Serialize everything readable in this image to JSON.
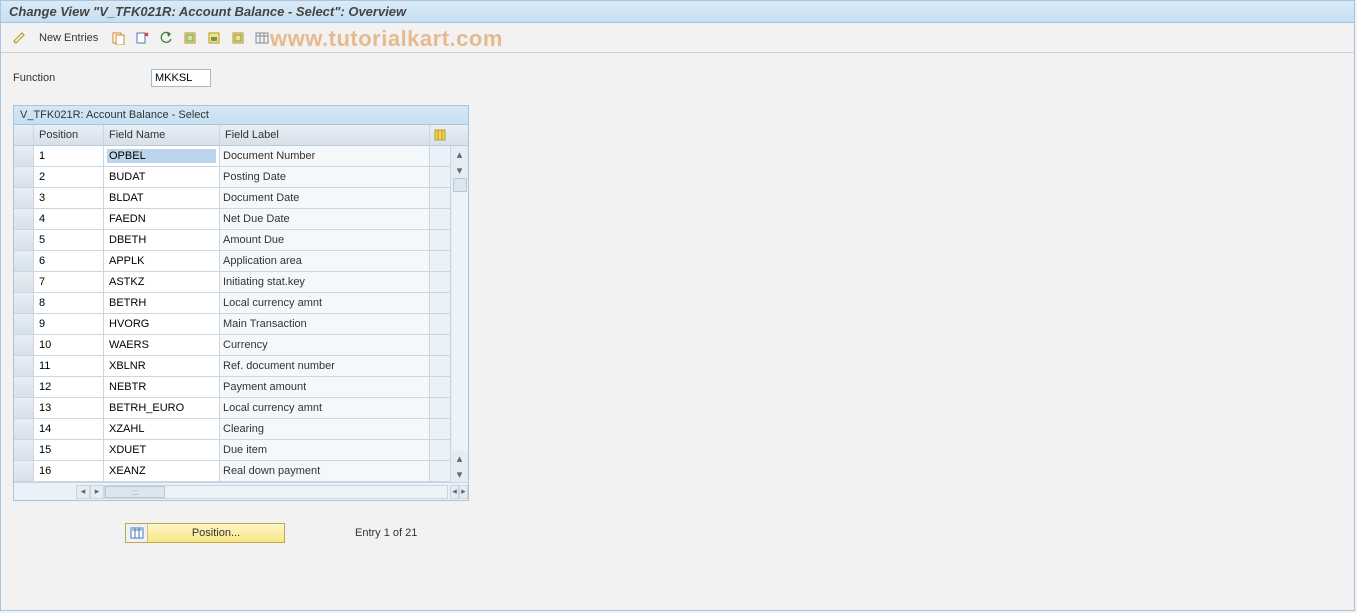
{
  "title": "Change View \"V_TFK021R: Account Balance - Select\": Overview",
  "watermark": "www.tutorialkart.com",
  "toolbar": {
    "new_entries_label": "New Entries"
  },
  "field": {
    "function_label": "Function",
    "function_value": "MKKSL"
  },
  "panel": {
    "title": "V_TFK021R: Account Balance - Select",
    "col_position": "Position",
    "col_fieldname": "Field Name",
    "col_fieldlabel": "Field Label",
    "rows": [
      {
        "pos": "1",
        "field": "OPBEL",
        "label": "Document Number"
      },
      {
        "pos": "2",
        "field": "BUDAT",
        "label": "Posting Date"
      },
      {
        "pos": "3",
        "field": "BLDAT",
        "label": "Document Date"
      },
      {
        "pos": "4",
        "field": "FAEDN",
        "label": "Net Due Date"
      },
      {
        "pos": "5",
        "field": "DBETH",
        "label": "Amount Due"
      },
      {
        "pos": "6",
        "field": "APPLK",
        "label": "Application area"
      },
      {
        "pos": "7",
        "field": "ASTKZ",
        "label": "Initiating stat.key"
      },
      {
        "pos": "8",
        "field": "BETRH",
        "label": "Local currency amnt"
      },
      {
        "pos": "9",
        "field": "HVORG",
        "label": "Main Transaction"
      },
      {
        "pos": "10",
        "field": "WAERS",
        "label": "Currency"
      },
      {
        "pos": "11",
        "field": "XBLNR",
        "label": "Ref. document number"
      },
      {
        "pos": "12",
        "field": "NEBTR",
        "label": "Payment amount"
      },
      {
        "pos": "13",
        "field": "BETRH_EURO",
        "label": "Local currency amnt"
      },
      {
        "pos": "14",
        "field": "XZAHL",
        "label": "Clearing"
      },
      {
        "pos": "15",
        "field": "XDUET",
        "label": "Due item"
      },
      {
        "pos": "16",
        "field": "XEANZ",
        "label": "Real down payment"
      }
    ]
  },
  "footer": {
    "position_label": "Position...",
    "entry_text": "Entry 1 of 21"
  }
}
